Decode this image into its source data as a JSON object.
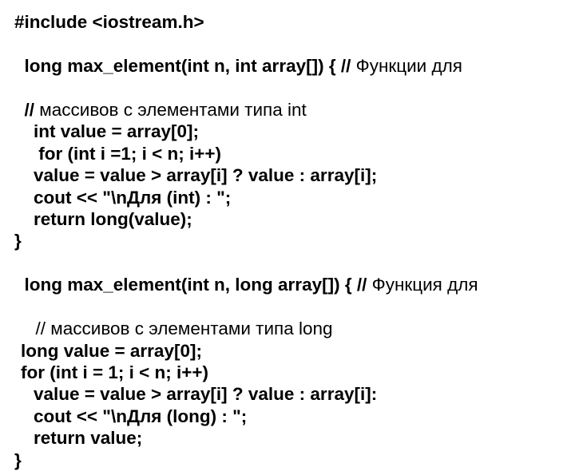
{
  "code": {
    "l1": "#include <iostream.h>",
    "l2a": "long mах_element(int n, int array[]) { // ",
    "l2b": "Функции для",
    "l3a": "// ",
    "l3b": "массивов с элементами типа int",
    "l4": "int value = array[0];",
    "l5": " for (int i =1; i < n; i++)",
    "l6": "value = value > array[i] ? value : array[i];",
    "l7": "cout << \"\\nДля (int) : \";",
    "l8": "return long(value);",
    "l9": "}",
    "l10a": "long mах_element(int n, long array[]) { // ",
    "l10b": "Функция для",
    "l11a": "// ",
    "l11b": "массивов с элементами типа long",
    "l12": "long value = array[0];",
    "l13": "for (int i = 1; i < n; i++)",
    "l14": "value = value > array[i] ? value : array[i]:",
    "l15": "cout << \"\\nДля (long) : \";",
    "l16": "return value;",
    "l17": "}"
  }
}
